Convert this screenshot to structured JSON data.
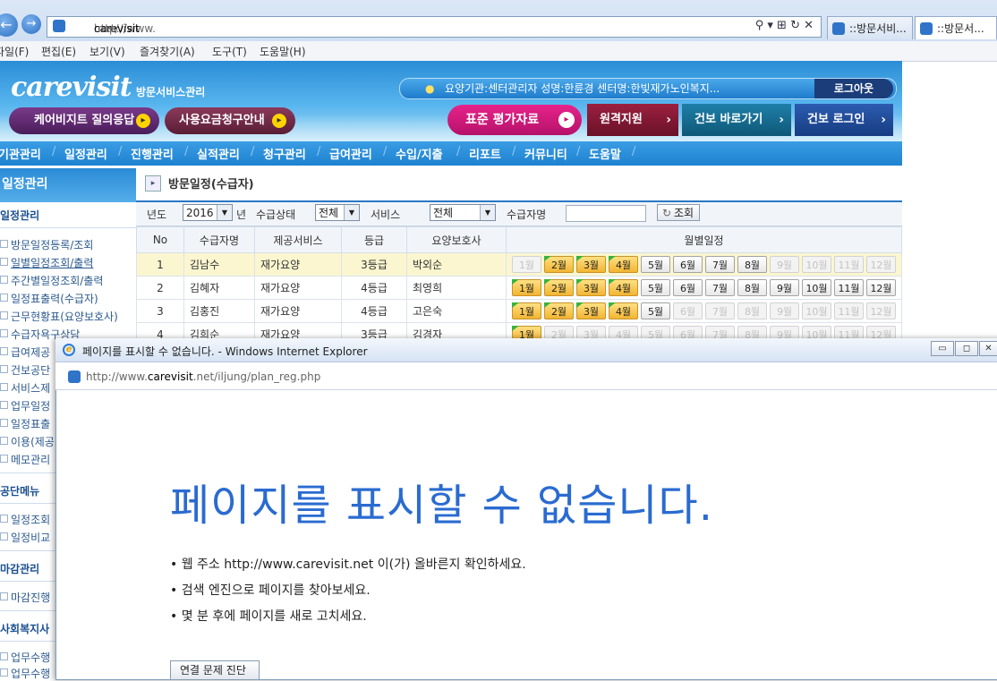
{
  "browser": {
    "url_prefix": "http://www.",
    "url_host": "carevisit",
    "url_suffix": ".net/",
    "tabs": [
      "::방문서비...",
      "::방문서..."
    ],
    "menu": [
      "파일(F)",
      "편집(E)",
      "보기(V)",
      "즐겨찾기(A)",
      "도구(T)",
      "도움말(H)"
    ]
  },
  "site": {
    "logo": "carevisit",
    "logo_sub": "방문서비스관리",
    "btn_qna": "케어비지트 질의응답",
    "btn_fee": "사용요금청구안내",
    "user_info": "요양기관:센터관리자      성명:한륜경      센터명:한빛재가노인복지...",
    "logout": "로그아웃",
    "quick": [
      "표준 평가자료",
      "원격지원",
      "건보 바로가기",
      "건보 로그인"
    ],
    "nav": [
      "기관관리",
      "일정관리",
      "진행관리",
      "실적관리",
      "청구관리",
      "급여관리",
      "수입/지출",
      "리포트",
      "커뮤니티",
      "도움말"
    ]
  },
  "sidebar": {
    "title": "일정관리",
    "groups": [
      {
        "title": "일정관리",
        "items": [
          "방문일정등록/조회",
          "일별일정조회/출력",
          "주간별일정조회/출력",
          "일정표출력(수급자)",
          "근무현황표(요양보호사)",
          "수급자욕구상담",
          "급여제공",
          "건보공단",
          "서비스제",
          "업무일정",
          "일정표출",
          "이용(제공",
          "메모관리"
        ]
      },
      {
        "title": "공단메뉴",
        "items": [
          "일정조회",
          "일정비교"
        ]
      },
      {
        "title": "마감관리",
        "items": [
          "마감진행"
        ]
      },
      {
        "title": "사회복지사",
        "items": [
          "업무수행",
          "업무수행"
        ]
      }
    ]
  },
  "main": {
    "page_title": "방문일정(수급자)",
    "filters": {
      "year_label": "년도",
      "year_value": "2016",
      "year_unit": "년",
      "status_label": "수급상태",
      "status_value": "전체",
      "service_label": "서비스",
      "service_value": "전체",
      "name_label": "수급자명",
      "search_button": "조회"
    },
    "columns": [
      "No",
      "수급자명",
      "제공서비스",
      "등급",
      "요양보호사",
      "월별일정"
    ],
    "month_labels": [
      "1월",
      "2월",
      "3월",
      "4월",
      "5월",
      "6월",
      "7월",
      "8월",
      "9월",
      "10월",
      "11월",
      "12월"
    ],
    "rows": [
      {
        "no": "1",
        "name": "김남수",
        "service": "재가요양",
        "grade": "3등급",
        "caregiver": "박외순",
        "months": [
          "off",
          "on",
          "on",
          "on",
          "white",
          "white",
          "white",
          "white",
          "off",
          "off",
          "off",
          "off"
        ],
        "flags": [
          1,
          2,
          3
        ]
      },
      {
        "no": "2",
        "name": "김혜자",
        "service": "재가요양",
        "grade": "4등급",
        "caregiver": "최영희",
        "months": [
          "on",
          "on",
          "on",
          "on",
          "white",
          "white",
          "white",
          "white",
          "white",
          "white",
          "white",
          "white"
        ],
        "flags": [
          0,
          1,
          2,
          3
        ]
      },
      {
        "no": "3",
        "name": "김홍진",
        "service": "재가요양",
        "grade": "4등급",
        "caregiver": "고은숙",
        "months": [
          "on",
          "on",
          "on",
          "on",
          "white",
          "off",
          "off",
          "off",
          "off",
          "off",
          "off",
          "off"
        ],
        "flags": [
          0,
          1,
          2,
          3
        ]
      },
      {
        "no": "4",
        "name": "김희순",
        "service": "재가요양",
        "grade": "3등급",
        "caregiver": "김경자",
        "months": [
          "on",
          "off",
          "off",
          "off",
          "off",
          "off",
          "off",
          "off",
          "off",
          "off",
          "off",
          "off"
        ],
        "flags": [
          0
        ]
      }
    ]
  },
  "popup": {
    "title": "페이지를 표시할 수 없습니다. - Windows Internet Explorer",
    "url_prefix": "http://www.",
    "url_host": "carevisit",
    "url_suffix": ".net/iljung/plan_reg.php",
    "error_title": "페이지를 표시할 수 없습니다.",
    "bullets": [
      "웹 주소 http://www.carevisit.net 이(가) 올바른지 확인하세요.",
      "검색 엔진으로 페이지를 찾아보세요.",
      "몇 분 후에 페이지를 새로 고치세요."
    ],
    "diag_button": "연결 문제 진단"
  },
  "colors": {
    "accent_blue": "#2a78c6",
    "error_title": "#2a6bd1",
    "month_on": "#f2b531",
    "flag_green": "#37b33b"
  }
}
